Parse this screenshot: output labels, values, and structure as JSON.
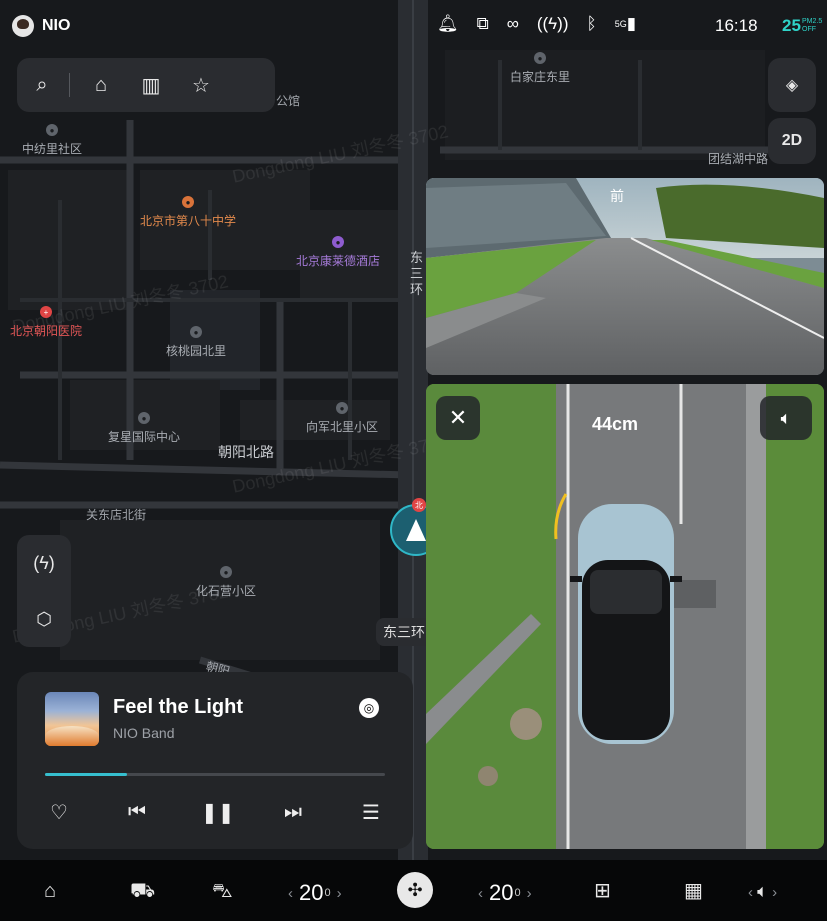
{
  "status_bar": {
    "profile_name": "NIO",
    "icons": [
      "bell-icon",
      "cast-icon",
      "link-icon",
      "charge-signal-icon",
      "bluetooth-icon",
      "5g-signal-icon"
    ],
    "network": "5G",
    "clock": "16:18",
    "temperature": "25",
    "aqi_label": "PM2.5",
    "aqi_state": "OFF"
  },
  "search_bar": {
    "icons": [
      "search-icon",
      "home-icon",
      "building-icon",
      "star-icon"
    ]
  },
  "map": {
    "poi": [
      {
        "label": "中纺里社区",
        "kind": "gray"
      },
      {
        "label": "北京市第八十中学",
        "kind": "orange"
      },
      {
        "label": "北京康莱德酒店",
        "kind": "purple"
      },
      {
        "label": "北京朝阳医院",
        "kind": "red"
      },
      {
        "label": "核桃园北里",
        "kind": "gray"
      },
      {
        "label": "复星国际中心",
        "kind": "gray"
      },
      {
        "label": "向军北里小区",
        "kind": "gray"
      },
      {
        "label": "化石营小区",
        "kind": "gray"
      },
      {
        "label": "白家庄东里",
        "kind": "gray"
      },
      {
        "label": "团结湖中路",
        "kind": "gray"
      }
    ],
    "roads": {
      "main": "朝阳北路",
      "street": "关东店北街",
      "gongguan": "公馆",
      "ring_vertical": "东三环",
      "ring_chip": "东三环",
      "bottom_partial": "朝阳"
    },
    "watermark": "Dongdong LIU 刘冬冬 3702",
    "controls": {
      "layers_icon": "layers-icon",
      "view_mode": "2D"
    },
    "side_panel_icons": [
      "charging-station-icon",
      "settings-hex-icon"
    ],
    "nav_badge": "北"
  },
  "media": {
    "title": "Feel the Light",
    "artist": "NIO Band",
    "progress": 0.24,
    "controls": [
      "heart-icon",
      "previous-icon",
      "pause-icon",
      "next-icon",
      "playlist-icon"
    ]
  },
  "camera": {
    "front_label": "前",
    "distance": "44cm",
    "close_icon": "close-icon",
    "sound_icon": "sound-icon"
  },
  "dock": {
    "items": [
      "home-icon",
      "car-icon",
      "car-door-icon",
      "fan-icon",
      "defrost-icon",
      "apps-grid-icon",
      "volume-icon"
    ],
    "left_temp": "20",
    "right_temp": "20",
    "temp_decimal": "0"
  }
}
